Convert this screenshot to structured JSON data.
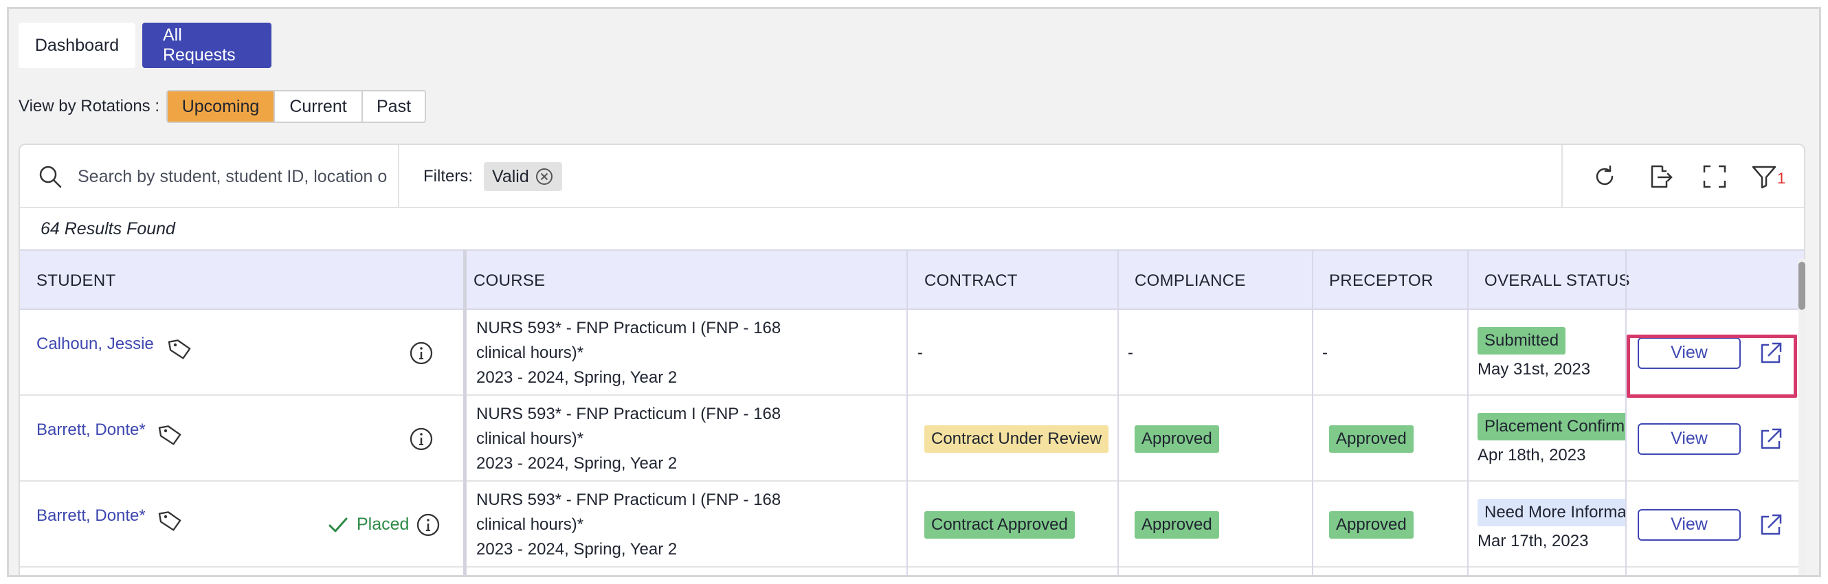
{
  "tabs": [
    {
      "label": "Dashboard",
      "active": false
    },
    {
      "label": "All Requests",
      "active": true
    }
  ],
  "rotations": {
    "label": "View by Rotations :",
    "options": [
      "Upcoming",
      "Current",
      "Past"
    ],
    "selected": "Upcoming",
    "selected_color": "#f0a544"
  },
  "search": {
    "placeholder": "Search by student, student ID, location or course",
    "value": ""
  },
  "filters": {
    "label": "Filters:",
    "chips": [
      "Valid"
    ]
  },
  "toolbar": {
    "filter_count": "1"
  },
  "results_text": "64 Results Found",
  "columns": [
    "STUDENT",
    "COURSE",
    "CONTRACT",
    "COMPLIANCE",
    "PRECEPTOR",
    "OVERALL STATUS"
  ],
  "rows": [
    {
      "student": "Calhoun, Jessie",
      "placed": "",
      "course_line1": "NURS 593* - FNP Practicum I (FNP - 168",
      "course_line2": "clinical hours)*",
      "course_line3": "2023 - 2024, Spring, Year 2",
      "contract": "-",
      "compliance": "-",
      "preceptor": "-",
      "status": "Submitted",
      "status_date": "May 31st, 2023",
      "view_label": "View"
    },
    {
      "student": "Barrett, Donte*",
      "placed": "",
      "course_line1": "NURS 593* - FNP Practicum I (FNP - 168",
      "course_line2": "clinical hours)*",
      "course_line3": "2023 - 2024, Spring, Year 2",
      "contract": "Contract Under Review",
      "compliance": "Approved",
      "preceptor": "Approved",
      "status": "Placement Confirmed",
      "status_date": "Apr 18th, 2023",
      "view_label": "View"
    },
    {
      "student": "Barrett, Donte*",
      "placed": "Placed",
      "course_line1": "NURS 593* - FNP Practicum I (FNP - 168",
      "course_line2": "clinical hours)*",
      "course_line3": "2023 - 2024, Spring, Year 2",
      "contract": "Contract Approved",
      "compliance": "Approved",
      "preceptor": "Approved",
      "status": "Need More Information",
      "status_date": "Mar 17th, 2023",
      "view_label": "View"
    }
  ],
  "colors": {
    "accent": "#3f48b2",
    "approved": "#7fc98a",
    "under_review": "#f5e2a0",
    "info_status": "#dce6fb",
    "highlight": "#d63a6b"
  }
}
